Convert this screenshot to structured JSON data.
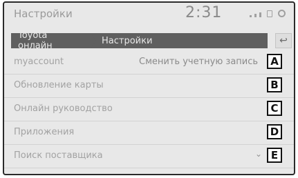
{
  "status": {
    "title": "Настройки",
    "clock": "2:31"
  },
  "breadcrumb": {
    "items": [
      "Toyota онлайн",
      "Настройки"
    ]
  },
  "menu": {
    "rows": [
      {
        "label": "myaccount",
        "value": "Сменить учетную запись",
        "badge": "A"
      },
      {
        "label": "Обновление карты",
        "badge": "B"
      },
      {
        "label": "Онлайн руководство",
        "badge": "C"
      },
      {
        "label": "Приложения",
        "badge": "D"
      },
      {
        "label": "Поиск поставщика",
        "badge": "E"
      }
    ]
  }
}
